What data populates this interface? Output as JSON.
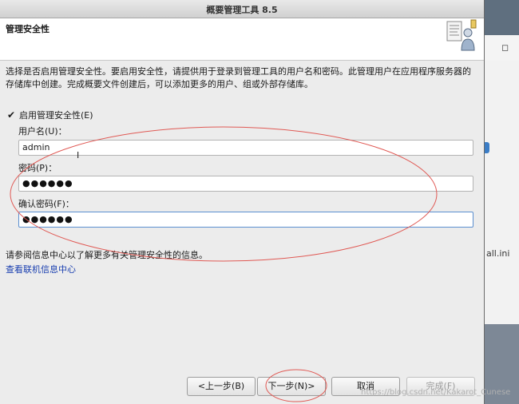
{
  "window": {
    "title": "概要管理工具 8.5"
  },
  "header": {
    "title": "管理安全性",
    "icon": "wizard-person-icon"
  },
  "description": "选择是否启用管理安全性。要启用安全性，请提供用于登录到管理工具的用户名和密码。此管理用户在应用程序服务器的存储库中创建。完成概要文件创建后，可以添加更多的用户、组或外部存储库。",
  "security": {
    "enable_label": "启用管理安全性(E)",
    "enabled": true,
    "username_label": "用户名(U)：",
    "username_value": "admin",
    "password_label": "密码(P)：",
    "password_mask": "●●●●●●",
    "confirm_label": "确认密码(F)：",
    "confirm_mask": "●●●●●●"
  },
  "info": {
    "text": "请参阅信息中心以了解更多有关管理安全性的信息。",
    "link": "查看联机信息中心"
  },
  "buttons": {
    "back": "<上一步(B)",
    "next": "下一步(N)>",
    "cancel": "取消",
    "finish": "完成(F)"
  },
  "background_window": {
    "filename": "all.ini",
    "restore_glyph": "◻"
  },
  "watermark": "https://blog.csdn.net/Kakarot_Cunese",
  "colors": {
    "annotation": "#e05a55",
    "link": "#1a3fb0",
    "focus": "#5b8fd0"
  }
}
